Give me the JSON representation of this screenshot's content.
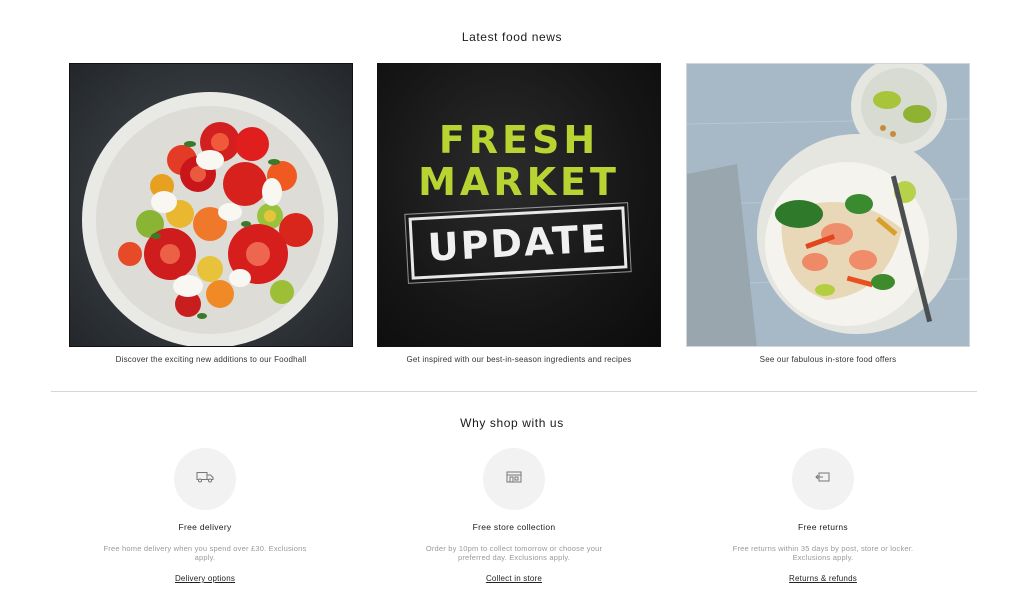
{
  "news": {
    "title": "Latest food news",
    "cards": [
      {
        "caption": "Discover the exciting new additions to our Foodhall"
      },
      {
        "caption": "Get inspired with our best-in-season ingredients and recipes",
        "image_text": {
          "line1": "FRESH",
          "line2": "MARKET",
          "line3": "UPDATE"
        }
      },
      {
        "caption": "See our fabulous in-store food offers"
      }
    ]
  },
  "why": {
    "title": "Why shop with us",
    "features": [
      {
        "icon": "delivery-van-icon",
        "title": "Free delivery",
        "desc": "Free home delivery when you spend over £30. Exclusions apply.",
        "link": "Delivery options"
      },
      {
        "icon": "store-icon",
        "title": "Free store collection",
        "desc": "Order by 10pm to collect tomorrow or choose your preferred day. Exclusions apply.",
        "link": "Collect in store"
      },
      {
        "icon": "returns-icon",
        "title": "Free returns",
        "desc": "Free returns within 35 days by post, store or locker. Exclusions apply.",
        "link": "Returns & refunds"
      }
    ]
  },
  "colors": {
    "fresh_market_green": "#b8d432",
    "icon_circle": "#f2f2f2"
  }
}
